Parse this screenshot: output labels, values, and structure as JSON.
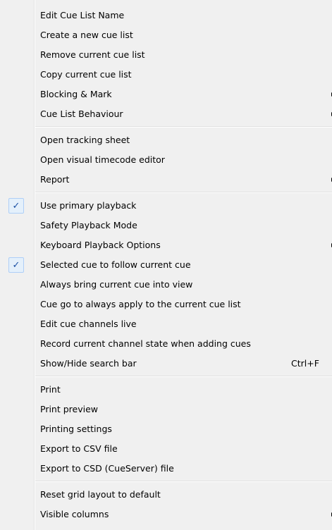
{
  "menu": {
    "groups": [
      {
        "items": [
          {
            "label": "Edit Cue List Name"
          },
          {
            "label": "Create a new cue list"
          },
          {
            "label": "Remove current cue list"
          },
          {
            "label": "Copy current cue list"
          },
          {
            "label": "Blocking & Mark"
          },
          {
            "label": "Cue List Behaviour"
          }
        ]
      },
      {
        "items": [
          {
            "label": "Open tracking sheet"
          },
          {
            "label": "Open visual timecode editor"
          },
          {
            "label": "Report"
          }
        ]
      },
      {
        "items": [
          {
            "label": "Use primary playback",
            "check": "✓"
          },
          {
            "label": "Safety Playback Mode"
          },
          {
            "label": "Keyboard Playback Options"
          },
          {
            "label": "Selected cue to follow current cue",
            "check": "✓"
          },
          {
            "label": "Always bring current cue into view"
          },
          {
            "label": "Cue go to always apply to the current cue list"
          },
          {
            "label": "Edit cue channels live"
          },
          {
            "label": "Record current channel state when adding cues"
          },
          {
            "label": "Show/Hide search bar",
            "shortcut": "Ctrl+F"
          }
        ]
      },
      {
        "items": [
          {
            "label": "Print"
          },
          {
            "label": "Print preview"
          },
          {
            "label": "Printing settings"
          },
          {
            "label": "Export to CSV file"
          },
          {
            "label": "Export to CSD (CueServer) file"
          }
        ]
      },
      {
        "items": [
          {
            "label": "Reset grid layout to default"
          },
          {
            "label": "Visible columns"
          }
        ]
      }
    ]
  }
}
